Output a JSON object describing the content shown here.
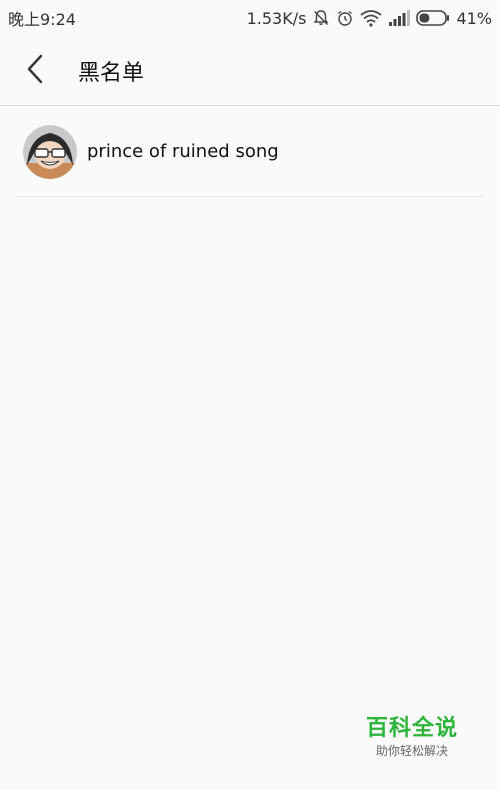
{
  "status_bar": {
    "time": "晚上9:24",
    "net_speed": "1.53K/s",
    "battery": "41%",
    "battery_level": 0.41,
    "icons": [
      "mute-bell-icon",
      "alarm-clock-icon",
      "wifi-icon",
      "signal-icon",
      "battery-icon"
    ]
  },
  "header": {
    "title": "黑名单",
    "back_icon": "chevron-left-icon"
  },
  "blacklist": {
    "items": [
      {
        "name": "prince of ruined song"
      }
    ]
  },
  "watermark": {
    "title": "百科全说",
    "subtitle": "助你轻松解决"
  },
  "colors": {
    "background": "#fafafa",
    "watermark_green": "#2db43a",
    "divider": "#d9d9d9"
  }
}
